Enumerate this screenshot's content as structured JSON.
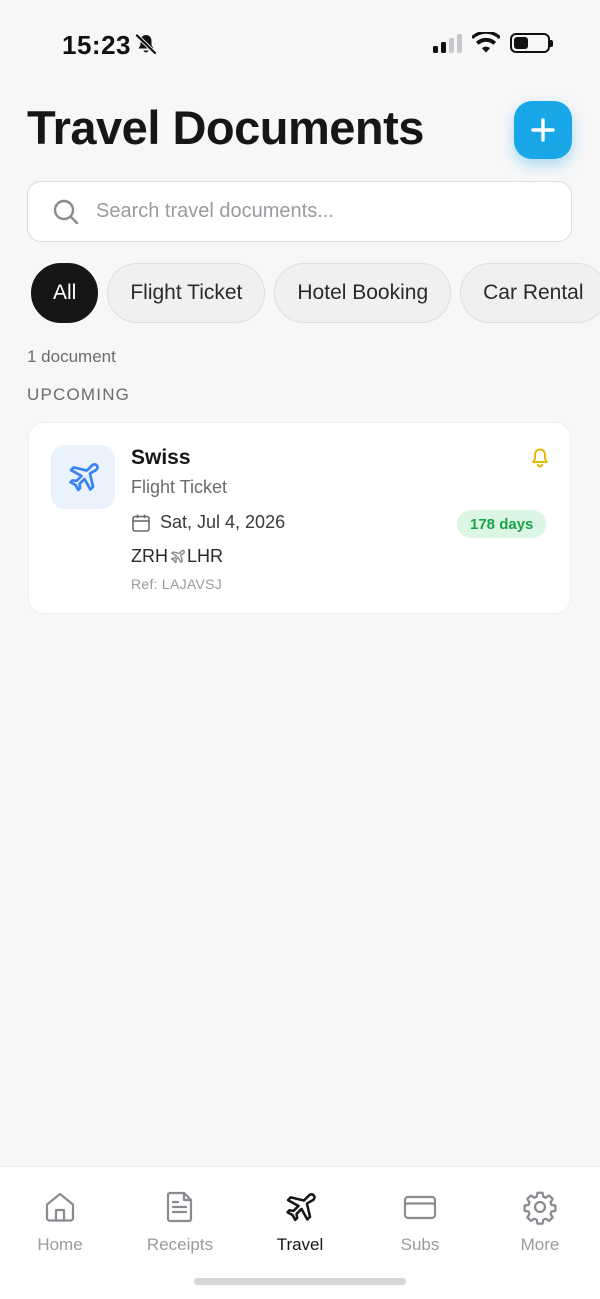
{
  "status_bar": {
    "time": "15:23"
  },
  "header": {
    "title": "Travel Documents",
    "add_label": "+"
  },
  "search": {
    "placeholder": "Search travel documents...",
    "value": ""
  },
  "filters": [
    {
      "label": "All",
      "active": true
    },
    {
      "label": "Flight Ticket",
      "active": false
    },
    {
      "label": "Hotel Booking",
      "active": false
    },
    {
      "label": "Car Rental",
      "active": false
    }
  ],
  "summary": {
    "count_text": "1 document",
    "section": "UPCOMING"
  },
  "documents": [
    {
      "title": "Swiss",
      "type": "Flight Ticket",
      "date": "Sat, Jul 4, 2026",
      "origin": "ZRH",
      "destination": "LHR",
      "ref_label": "Ref:",
      "ref": "LAJAVSJ",
      "days_until": "178 days",
      "icon": "airplane-icon",
      "reminder": true
    }
  ],
  "tabs": [
    {
      "label": "Home",
      "icon": "home-icon",
      "active": false
    },
    {
      "label": "Receipts",
      "icon": "receipt-icon",
      "active": false
    },
    {
      "label": "Travel",
      "icon": "airplane-icon",
      "active": true
    },
    {
      "label": "Subs",
      "icon": "card-icon",
      "active": false
    },
    {
      "label": "More",
      "icon": "gear-icon",
      "active": false
    }
  ],
  "colors": {
    "accent": "#1aa7e8",
    "active_chip": "#161616",
    "badge_bg": "#dcf6e4",
    "badge_text": "#17a34a",
    "reminder": "#e6b800",
    "icon_tile": "#e9f2fd",
    "icon_blue": "#3b82f6"
  }
}
